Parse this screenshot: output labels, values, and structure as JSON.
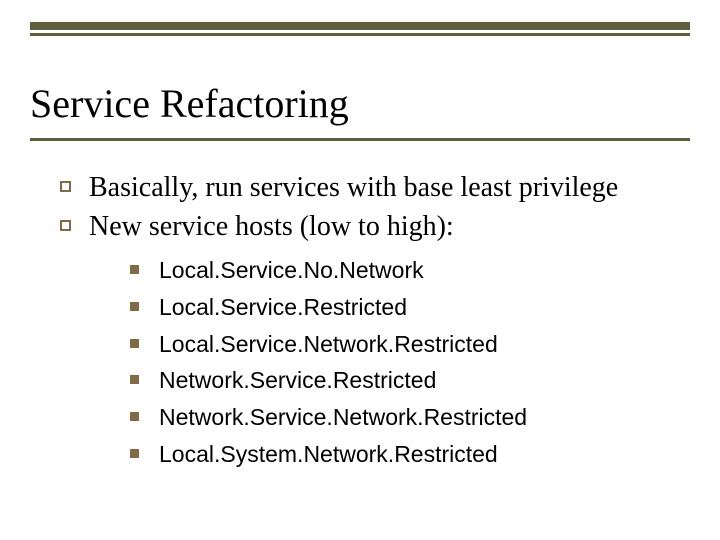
{
  "title": "Service Refactoring",
  "points": [
    "Basically, run services with base least privilege",
    "New service hosts (low to high):"
  ],
  "sublist": [
    "Local.Service.No.Network",
    "Local.Service.Restricted",
    "Local.Service.Network.Restricted",
    "Network.Service.Restricted",
    "Network.Service.Network.Restricted",
    "Local.System.Network.Restricted"
  ]
}
